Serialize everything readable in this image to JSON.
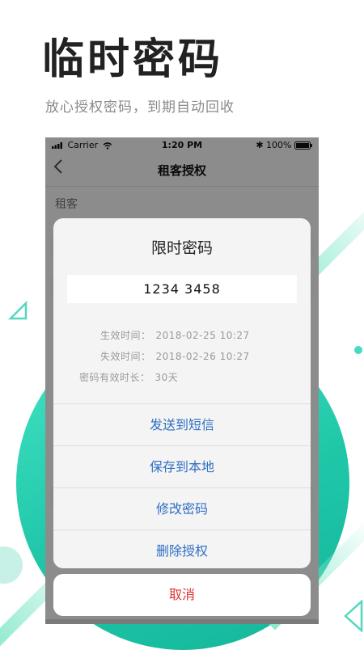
{
  "promo": {
    "title": "临时密码",
    "subtitle": "放心授权密码，到期自动回收"
  },
  "status_bar": {
    "carrier": "Carrier",
    "time": "1:20 PM",
    "battery": "100%"
  },
  "nav": {
    "back_icon": "chevron-left-icon",
    "title": "租客授权"
  },
  "page": {
    "section_label": "租客"
  },
  "sheet": {
    "title": "限时密码",
    "password": "1234 3458",
    "info": [
      {
        "label": "生效时间：",
        "value": "2018-02-25  10:27"
      },
      {
        "label": "失效时间：",
        "value": "2018-02-26  10:27"
      },
      {
        "label": "密码有效时长：",
        "value": "30天"
      }
    ],
    "actions": [
      {
        "label": "发送到短信"
      },
      {
        "label": "保存到本地"
      },
      {
        "label": "修改密码"
      },
      {
        "label": "删除授权"
      }
    ],
    "cancel_label": "取消"
  },
  "colors": {
    "accent": "#2f6fc2",
    "danger": "#e0322f",
    "brand_teal": "#1fc7a8"
  }
}
